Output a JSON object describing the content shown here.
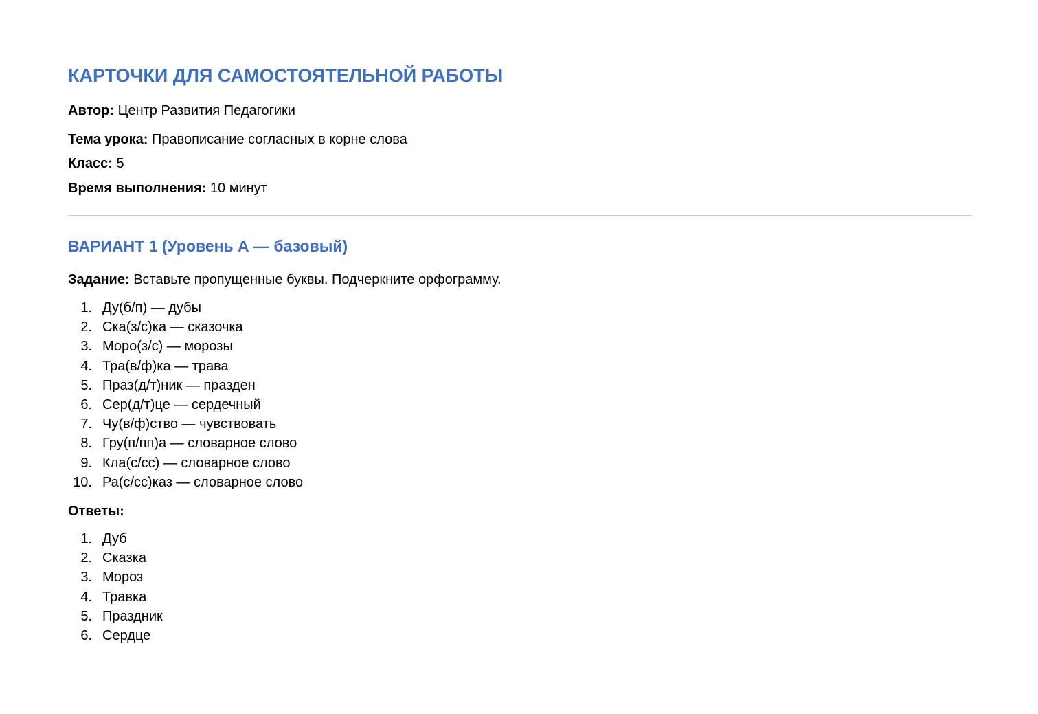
{
  "document": {
    "title": "КАРТОЧКИ ДЛЯ САМОСТОЯТЕЛЬНОЙ РАБОТЫ",
    "meta": [
      {
        "label": "Автор:",
        "value": "Центр Развития Педагогики"
      },
      {
        "label": "Тема урока:",
        "value": "Правописание согласных в корне слова"
      },
      {
        "label": "Класс:",
        "value": "5"
      },
      {
        "label": "Время выполнения:",
        "value": "10 минут"
      }
    ],
    "accent_color": "#3d6fc4"
  },
  "variant": {
    "title": "ВАРИАНТ 1 (Уровень А — базовый)",
    "task_label": "Задание:",
    "task_text": "Вставьте пропущенные буквы. Подчеркните орфограмму.",
    "items": [
      {
        "num": "1.",
        "text": "Ду(б/п) — дубы"
      },
      {
        "num": "2.",
        "text": "Ска(з/с)ка — сказочка"
      },
      {
        "num": "3.",
        "text": "Моро(з/с) — морозы"
      },
      {
        "num": "4.",
        "text": "Тра(в/ф)ка — трава"
      },
      {
        "num": "5.",
        "text": "Праз(д/т)ник — празден"
      },
      {
        "num": "6.",
        "text": "Сер(д/т)це — сердечный"
      },
      {
        "num": "7.",
        "text": "Чу(в/ф)ство — чувствовать"
      },
      {
        "num": "8.",
        "text": "Гру(п/пп)а — словарное слово"
      },
      {
        "num": "9.",
        "text": "Кла(с/сс) — словарное слово"
      },
      {
        "num": "10.",
        "text": "Ра(с/сс)каз — словарное слово"
      }
    ],
    "answers_label": "Ответы:",
    "answers": [
      {
        "num": "1.",
        "text": "Дуб"
      },
      {
        "num": "2.",
        "text": "Сказка"
      },
      {
        "num": "3.",
        "text": "Мороз"
      },
      {
        "num": "4.",
        "text": "Травка"
      },
      {
        "num": "5.",
        "text": "Праздник"
      },
      {
        "num": "6.",
        "text": "Сердце"
      }
    ]
  }
}
